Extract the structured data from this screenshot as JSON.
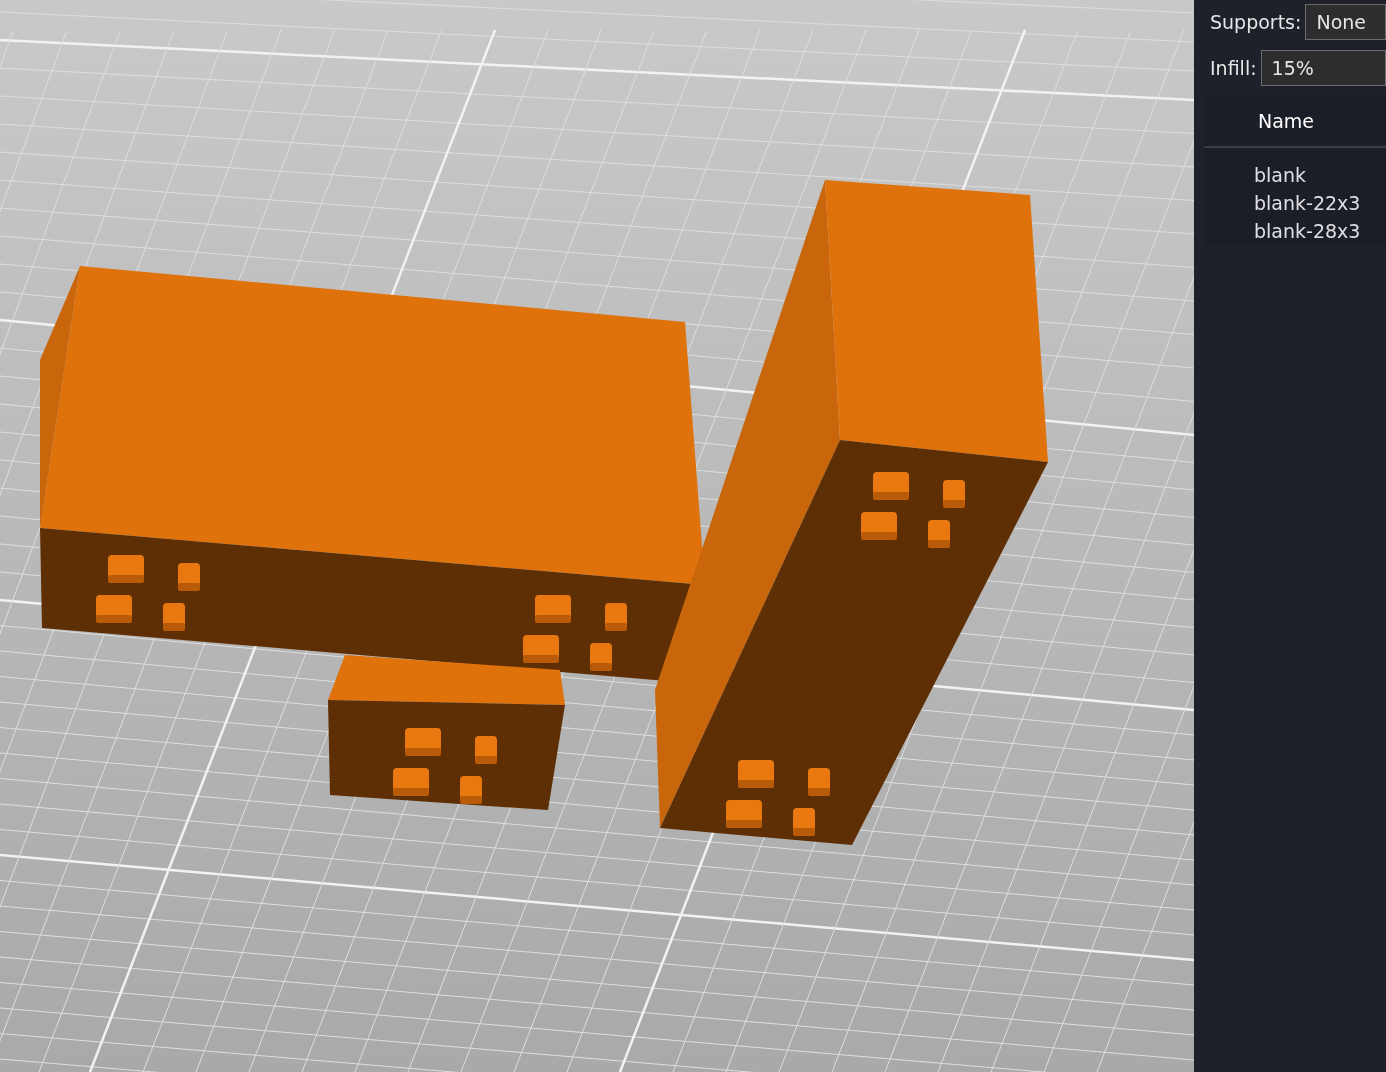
{
  "settings": [
    {
      "label": "Supports:",
      "value": "None"
    },
    {
      "label": "Infill:",
      "value": "15%"
    }
  ],
  "object_list": {
    "columns": [
      "Name"
    ],
    "rows": [
      {
        "name": "blank"
      },
      {
        "name": "blank-22x3"
      },
      {
        "name": "blank-28x3"
      }
    ]
  }
}
